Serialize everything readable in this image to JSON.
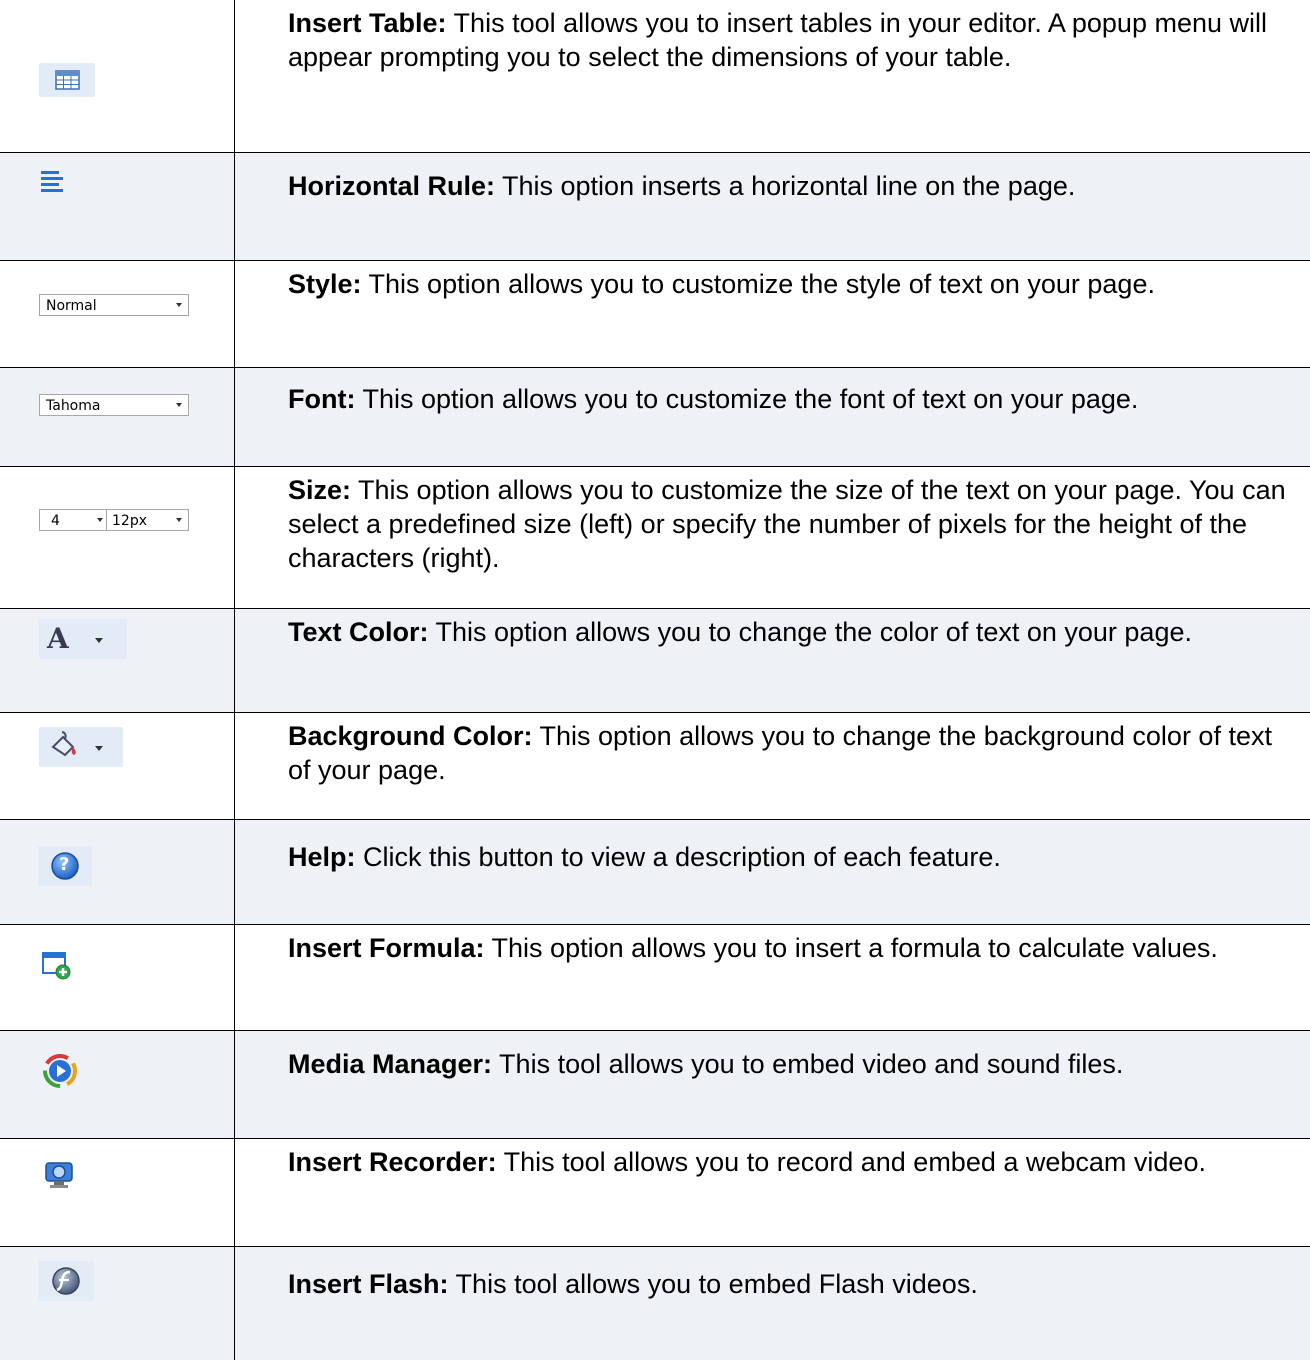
{
  "rows": [
    {
      "term": "Insert Table:",
      "desc": " This tool allows you to insert tables in your editor. A popup menu will appear prompting you to select the dimensions of your table.",
      "icon": "table-icon"
    },
    {
      "term": "Horizontal Rule:",
      "desc": " This option inserts a horizontal line on the page.",
      "icon": "horizontal-rule-icon"
    },
    {
      "term": "Style:",
      "desc": " This option allows you to customize the style of text on your page.",
      "icon": "style-select",
      "select_value": "Normal"
    },
    {
      "term": "Font:",
      "desc": " This option allows you to customize the font of text on your page.",
      "icon": "font-select",
      "select_value": "Tahoma"
    },
    {
      "term": "Size:",
      "desc": " This option allows you to customize the size of the text on your page. You can select a predefined size (left) or specify the number of pixels for the height of the characters (right).",
      "icon": "size-select",
      "select_value_left": "4",
      "select_value_right": "12px"
    },
    {
      "term": "Text Color:",
      "desc": " This option allows you to change the color of text on your page.",
      "icon": "text-color-icon",
      "glyph": "A"
    },
    {
      "term": "Background Color:",
      "desc": " This option allows you to change the background color of text of your page.",
      "icon": "paint-bucket-icon"
    },
    {
      "term": "Help:",
      "desc": " Click this button to view a description of each feature.",
      "icon": "help-icon",
      "glyph": "?"
    },
    {
      "term": "Insert Formula:",
      "desc": " This option allows you to insert a formula to calculate values.",
      "icon": "insert-formula-icon"
    },
    {
      "term": "Media Manager:",
      "desc": " This tool allows you to embed video and sound files.",
      "icon": "media-manager-icon"
    },
    {
      "term": "Insert Recorder:",
      "desc": "  This tool allows you to record and embed a webcam video.",
      "icon": "webcam-icon"
    },
    {
      "term": "Insert Flash:",
      "desc": " This tool allows you to embed Flash videos.",
      "icon": "flash-icon"
    }
  ],
  "colors": {
    "row_shade": "#eef1f5",
    "icon_bg": "#e3ebf6",
    "accent_blue": "#2a6fd6"
  }
}
